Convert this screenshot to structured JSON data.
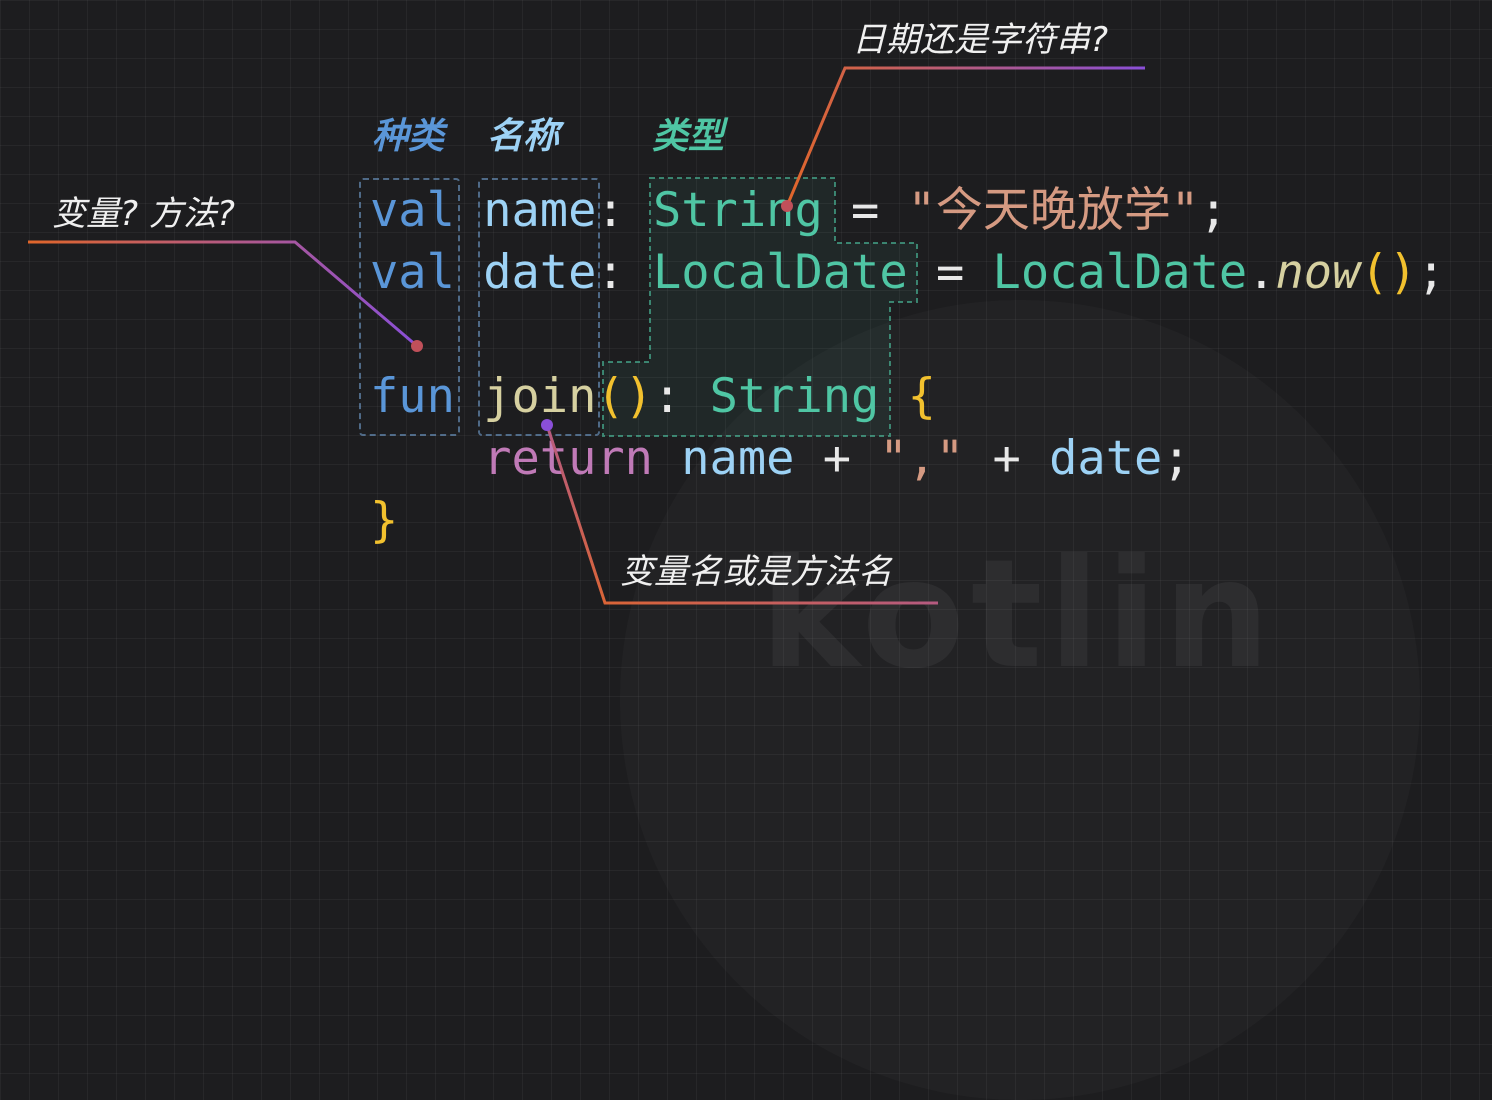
{
  "headers": {
    "kind": "种类",
    "name": "名称",
    "type": "类型"
  },
  "code": {
    "line1": {
      "kw": "val",
      "name": "name",
      "colon": ":",
      "type": "String",
      "eq": "=",
      "str": "\"今天晚放学\"",
      "end": ";"
    },
    "line2": {
      "kw": "val",
      "name": "date",
      "colon": ":",
      "type": "LocalDate",
      "eq": "=",
      "cls": "LocalDate",
      "dot": ".",
      "method": "now",
      "paren_open": "(",
      "paren_close": ")",
      "end": ";"
    },
    "line3": {
      "kw": "fun",
      "name": "join",
      "paren_open": "(",
      "paren_close": ")",
      "colon": ":",
      "type": "String",
      "brace": "{"
    },
    "line4": {
      "kw": "return",
      "a": "name",
      "plus1": "+",
      "str": "\",\"",
      "plus2": "+",
      "b": "date",
      "end": ";"
    },
    "line5": {
      "brace": "}"
    }
  },
  "annotations": {
    "type_question": "日期还是字符串?",
    "kind_question": "变量? 方法?",
    "name_note": "变量名或是方法名"
  },
  "colors": {
    "keyword": "#5a96d8",
    "identifier": "#9dd2f5",
    "type": "#4fc6a4",
    "string": "#d59a82",
    "function": "#d6d0a0",
    "paren": "#f2c12e",
    "return": "#c07ab7",
    "leader_start": "#e0662a",
    "leader_end": "#8a4fd8"
  }
}
